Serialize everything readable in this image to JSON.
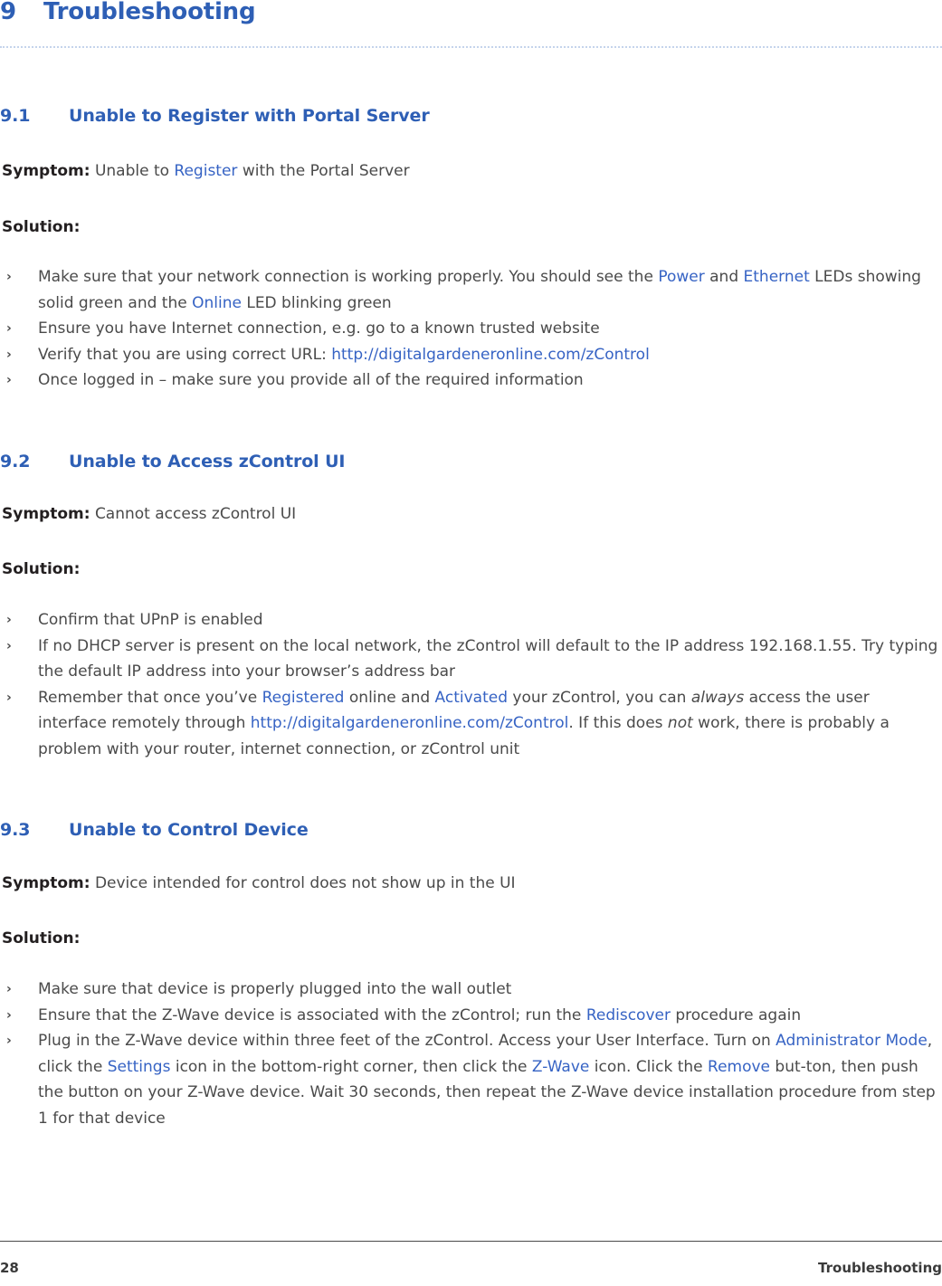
{
  "chapter": {
    "number": "9",
    "title": "Troubleshooting"
  },
  "sections": [
    {
      "number": "9.1",
      "title": "Unable to Register with Portal Server",
      "symptom_label": "Symptom:",
      "symptom_text_1": "Unable to ",
      "symptom_link": "Register",
      "symptom_text_2": " with the Portal Server",
      "solution_label": "Solution:",
      "bullets": [
        {
          "parts": [
            {
              "t": "Make sure that your network connection is working properly.  You should see the ",
              "s": "plain"
            },
            {
              "t": "Power",
              "s": "link"
            },
            {
              "t": " and ",
              "s": "plain"
            },
            {
              "t": "Ethernet",
              "s": "link"
            },
            {
              "t": " LEDs showing solid green and the ",
              "s": "plain"
            },
            {
              "t": "Online",
              "s": "link"
            },
            {
              "t": " LED blinking green",
              "s": "plain"
            }
          ]
        },
        {
          "parts": [
            {
              "t": "Ensure you have Internet connection, e.g. go to a known trusted website",
              "s": "plain"
            }
          ]
        },
        {
          "parts": [
            {
              "t": "Verify that you are using correct URL: ",
              "s": "plain"
            },
            {
              "t": "http://digitalgardeneronline.com/zControl",
              "s": "link"
            }
          ]
        },
        {
          "parts": [
            {
              "t": "Once logged in – make sure you provide all of the required information",
              "s": "plain"
            }
          ]
        }
      ]
    },
    {
      "number": "9.2",
      "title": "Unable to Access zControl UI",
      "symptom_label": "Symptom:",
      "symptom_text_1": "Cannot access zControl UI",
      "symptom_link": "",
      "symptom_text_2": "",
      "solution_label": "Solution:",
      "bullets": [
        {
          "parts": [
            {
              "t": "Confirm that UPnP is enabled",
              "s": "plain"
            }
          ]
        },
        {
          "parts": [
            {
              "t": "If no DHCP server is present on the local network, the zControl will default to the IP address 192.168.1.55. Try typing the default IP address into your browser’s address bar",
              "s": "plain"
            }
          ]
        },
        {
          "parts": [
            {
              "t": "Remember that once you’ve ",
              "s": "plain"
            },
            {
              "t": "Registered",
              "s": "link"
            },
            {
              "t": " online and ",
              "s": "plain"
            },
            {
              "t": "Activated",
              "s": "link"
            },
            {
              "t": " your zControl, you can ",
              "s": "plain"
            },
            {
              "t": "always",
              "s": "italic"
            },
            {
              "t": " access the user interface remotely through ",
              "s": "plain"
            },
            {
              "t": "http://digitalgardeneronline.com/zControl",
              "s": "link"
            },
            {
              "t": ". If this does ",
              "s": "plain"
            },
            {
              "t": "not",
              "s": "italic"
            },
            {
              "t": " work, there is probably a problem with your router, internet connection, or zControl unit",
              "s": "plain"
            }
          ]
        }
      ]
    },
    {
      "number": "9.3",
      "title": "Unable to Control Device",
      "symptom_label": "Symptom:",
      "symptom_text_1": "Device intended for control does not show up in the UI",
      "symptom_link": "",
      "symptom_text_2": "",
      "solution_label": "Solution:",
      "bullets": [
        {
          "parts": [
            {
              "t": "Make sure that device is properly plugged into the wall outlet",
              "s": "plain"
            }
          ]
        },
        {
          "parts": [
            {
              "t": "Ensure that the Z-Wave device is associated with the zControl; run the ",
              "s": "plain"
            },
            {
              "t": "Rediscover",
              "s": "link"
            },
            {
              "t": " procedure again",
              "s": "plain"
            }
          ]
        },
        {
          "parts": [
            {
              "t": "Plug in the Z-Wave device within three feet of the zControl. Access your User Interface. Turn on ",
              "s": "plain"
            },
            {
              "t": "Administrator Mode",
              "s": "link"
            },
            {
              "t": ", click the ",
              "s": "plain"
            },
            {
              "t": "Settings",
              "s": "link"
            },
            {
              "t": " icon in the bottom-right corner, then click the ",
              "s": "plain"
            },
            {
              "t": "Z-Wave",
              "s": "link"
            },
            {
              "t": " icon. Click the ",
              "s": "plain"
            },
            {
              "t": "Remove",
              "s": "link"
            },
            {
              "t": " but-ton, then push the button on your Z-Wave device. Wait 30 seconds, then repeat the Z-Wave device installation procedure from step 1 for that device",
              "s": "plain"
            }
          ]
        }
      ]
    }
  ],
  "footer": {
    "page_number": "28",
    "chapter_name": "Troubleshooting"
  },
  "colors": {
    "heading_blue": "#2E5FB5",
    "link_blue": "#3663C4",
    "body_gray": "#4a4a4a",
    "rule_dotted": "#c5d4ec"
  }
}
